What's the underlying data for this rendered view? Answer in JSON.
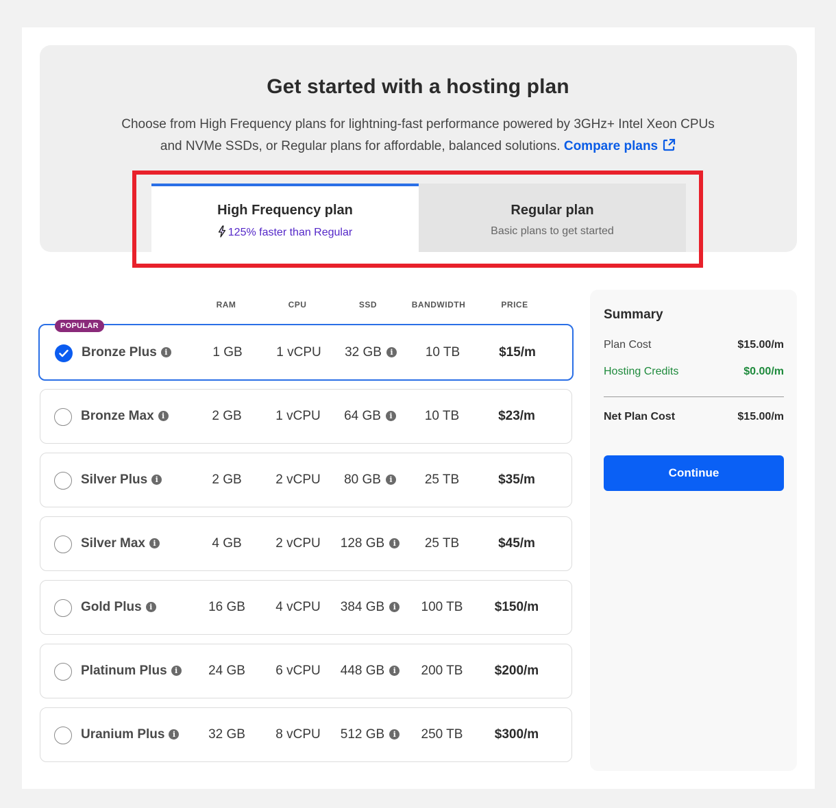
{
  "header": {
    "title": "Get started with a hosting plan",
    "description": "Choose from High Frequency plans for lightning-fast performance powered by 3GHz+ Intel Xeon CPUs and NVMe SSDs, or Regular plans for affordable, balanced solutions.",
    "compare_link": "Compare plans"
  },
  "tabs": [
    {
      "title": "High Frequency plan",
      "subtitle": "125% faster than Regular",
      "active": true
    },
    {
      "title": "Regular plan",
      "subtitle": "Basic plans to get started",
      "active": false
    }
  ],
  "columns": [
    "RAM",
    "CPU",
    "SSD",
    "BANDWIDTH",
    "PRICE"
  ],
  "popular_badge": "POPULAR",
  "plans": [
    {
      "name": "Bronze Plus",
      "ram": "1 GB",
      "cpu": "1 vCPU",
      "ssd": "32 GB",
      "bandwidth": "10 TB",
      "price": "$15/m",
      "selected": true
    },
    {
      "name": "Bronze Max",
      "ram": "2 GB",
      "cpu": "1 vCPU",
      "ssd": "64 GB",
      "bandwidth": "10 TB",
      "price": "$23/m",
      "selected": false
    },
    {
      "name": "Silver Plus",
      "ram": "2 GB",
      "cpu": "2 vCPU",
      "ssd": "80 GB",
      "bandwidth": "25 TB",
      "price": "$35/m",
      "selected": false
    },
    {
      "name": "Silver Max",
      "ram": "4 GB",
      "cpu": "2 vCPU",
      "ssd": "128 GB",
      "bandwidth": "25 TB",
      "price": "$45/m",
      "selected": false
    },
    {
      "name": "Gold Plus",
      "ram": "16 GB",
      "cpu": "4 vCPU",
      "ssd": "384 GB",
      "bandwidth": "100 TB",
      "price": "$150/m",
      "selected": false
    },
    {
      "name": "Platinum Plus",
      "ram": "24 GB",
      "cpu": "6 vCPU",
      "ssd": "448 GB",
      "bandwidth": "200 TB",
      "price": "$200/m",
      "selected": false
    },
    {
      "name": "Uranium Plus",
      "ram": "32 GB",
      "cpu": "8 vCPU",
      "ssd": "512 GB",
      "bandwidth": "250 TB",
      "price": "$300/m",
      "selected": false
    }
  ],
  "summary": {
    "title": "Summary",
    "plan_cost_label": "Plan Cost",
    "plan_cost": "$15.00/m",
    "credits_label": "Hosting Credits",
    "credits": "$0.00/m",
    "net_label": "Net Plan Cost",
    "net": "$15.00/m",
    "continue_label": "Continue"
  },
  "icons": {
    "info": "info-icon",
    "external": "external-link-icon",
    "bolt": "lightning-bolt-icon",
    "check": "checkmark-icon"
  },
  "colors": {
    "accent": "#0a60f5",
    "selected_border": "#2a6fe6",
    "highlight": "#e8212b",
    "credit_green": "#1e8a3c",
    "fast_purple": "#5427c8",
    "popular_badge": "#8a2a7a"
  }
}
